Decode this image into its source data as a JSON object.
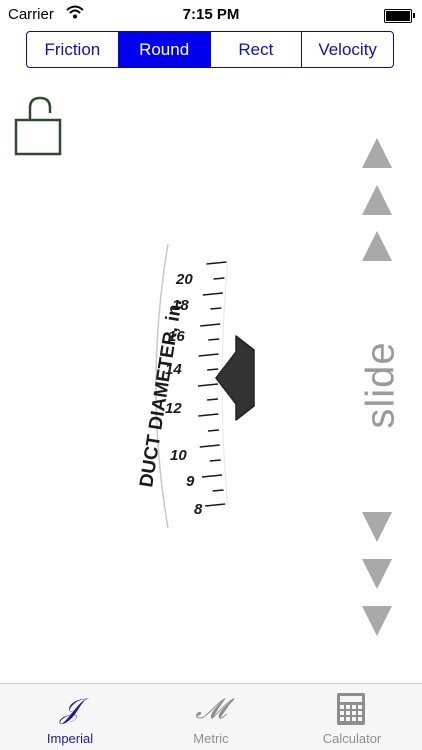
{
  "status": {
    "carrier": "Carrier",
    "time": "7:15 PM"
  },
  "segments": [
    {
      "label": "Friction",
      "active": false
    },
    {
      "label": "Round",
      "active": true
    },
    {
      "label": "Rect",
      "active": false
    },
    {
      "label": "Velocity",
      "active": false
    }
  ],
  "dial": {
    "title": "DUCT DIAMETER, in.",
    "labels": [
      "20",
      "18",
      "16",
      "14",
      "12",
      "10",
      "9",
      "8"
    ]
  },
  "slide_label": "slide",
  "tabs": [
    {
      "label": "Imperial",
      "icon_glyph": "𝒥",
      "icon": "imperial-icon",
      "active": true
    },
    {
      "label": "Metric",
      "icon_glyph": "𝓜",
      "icon": "metric-icon",
      "active": false
    },
    {
      "label": "Calculator",
      "icon": "calculator-icon",
      "active": false
    }
  ],
  "colors": {
    "accent": "#0000ee",
    "segment_border": "#0a0aa8",
    "lock": "#2f4a2f",
    "arrow": "#a9a9a9",
    "tab_active": "#1a1aa8",
    "tab_inactive": "#8e8e8e"
  }
}
